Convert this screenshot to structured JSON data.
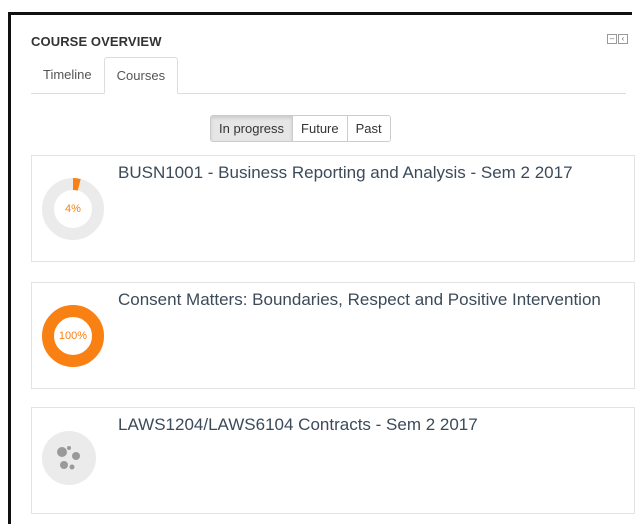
{
  "block": {
    "title": "COURSE OVERVIEW",
    "controls": [
      "minimise-icon",
      "collapse-left-icon"
    ]
  },
  "tabs": [
    {
      "label": "Timeline",
      "active": false
    },
    {
      "label": "Courses",
      "active": true
    }
  ],
  "filters": [
    {
      "label": "In progress",
      "active": true
    },
    {
      "label": "Future",
      "active": false
    },
    {
      "label": "Past",
      "active": false
    }
  ],
  "courses": [
    {
      "title": "BUSN1001 - Business Reporting and Analysis - Sem 2 2017",
      "progress_label": "4%",
      "progress": 0.04,
      "visual": "progress-ring"
    },
    {
      "title": "Consent Matters: Boundaries, Respect and Positive Intervention",
      "progress_label": "100%",
      "progress": 1.0,
      "visual": "progress-ring"
    },
    {
      "title": "LAWS1204/LAWS6104 Contracts - Sem 2 2017",
      "visual": "course-image-icon"
    }
  ],
  "colors": {
    "accent": "#f98012",
    "ring_track": "#ebebeb",
    "title_text": "#3b4b5a"
  }
}
